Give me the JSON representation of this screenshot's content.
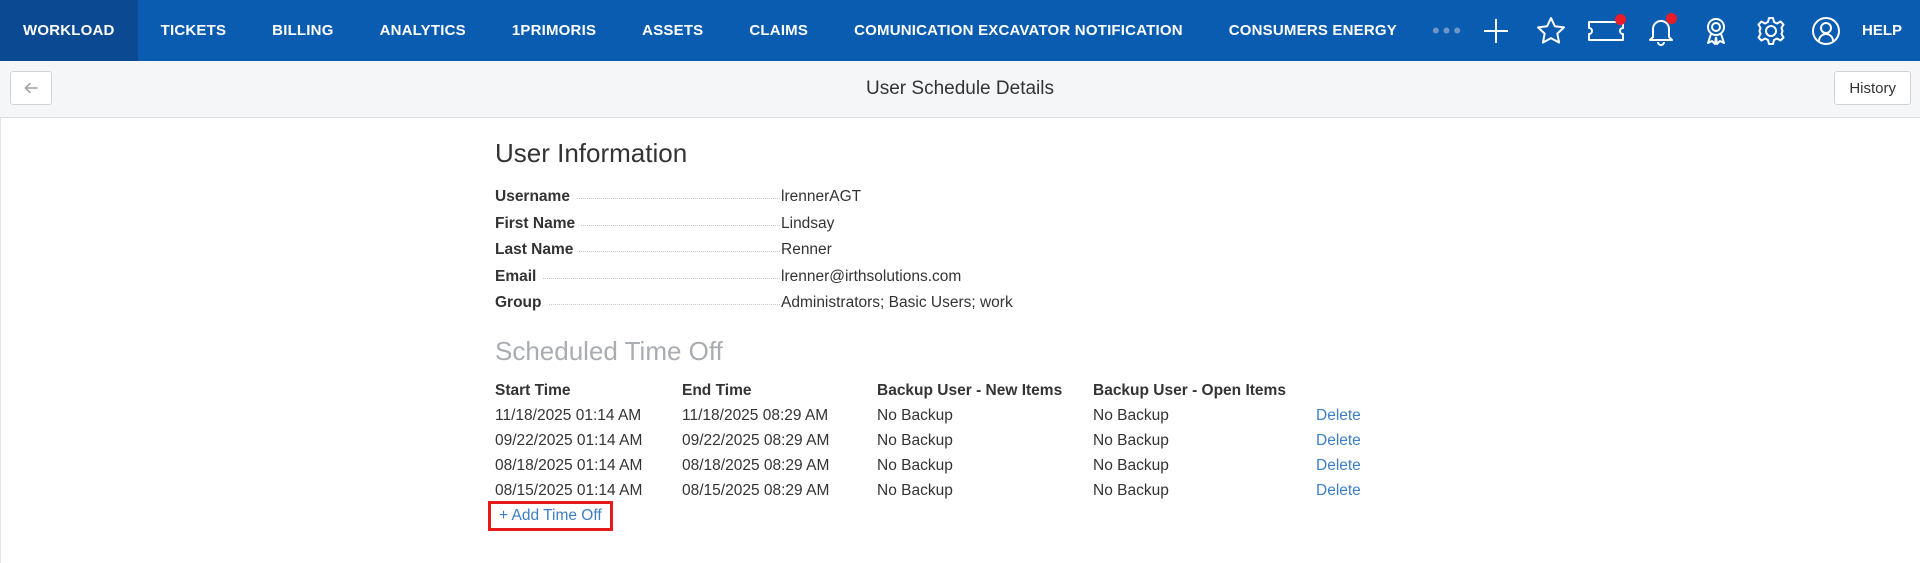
{
  "nav": {
    "items": [
      {
        "label": "WORKLOAD",
        "active": true
      },
      {
        "label": "TICKETS"
      },
      {
        "label": "BILLING"
      },
      {
        "label": "ANALYTICS"
      },
      {
        "label": "1PRIMORIS"
      },
      {
        "label": "ASSETS"
      },
      {
        "label": "CLAIMS"
      },
      {
        "label": "COMUNICATION EXCAVATOR NOTIFICATION"
      },
      {
        "label": "CONSUMERS ENERGY"
      }
    ],
    "more": "•••",
    "icons": [
      "plus-icon",
      "star-icon",
      "ticket-icon",
      "bell-icon",
      "award-icon",
      "gear-icon",
      "user-icon"
    ],
    "help": "HELP",
    "colors": {
      "bar": "#0a5cb0",
      "active": "#0b4a92",
      "notification_dot": "#ea1c2a"
    }
  },
  "header": {
    "title": "User Schedule Details",
    "history_label": "History"
  },
  "user_info": {
    "title": "User Information",
    "fields": [
      {
        "label": "Username",
        "value": "lrennerAGT"
      },
      {
        "label": "First Name",
        "value": "Lindsay"
      },
      {
        "label": "Last Name",
        "value": "Renner"
      },
      {
        "label": "Email",
        "value": "lrenner@irthsolutions.com"
      },
      {
        "label": "Group",
        "value": "Administrators; Basic Users; work"
      }
    ]
  },
  "schedule": {
    "title": "Scheduled Time Off",
    "columns": [
      "Start Time",
      "End Time",
      "Backup User - New Items",
      "Backup User - Open Items"
    ],
    "rows": [
      {
        "start": "11/18/2025 01:14 AM",
        "end": "11/18/2025 08:29 AM",
        "backup_new": "No Backup",
        "backup_open": "No Backup",
        "action": "Delete"
      },
      {
        "start": "09/22/2025 01:14 AM",
        "end": "09/22/2025 08:29 AM",
        "backup_new": "No Backup",
        "backup_open": "No Backup",
        "action": "Delete"
      },
      {
        "start": "08/18/2025 01:14 AM",
        "end": "08/18/2025 08:29 AM",
        "backup_new": "No Backup",
        "backup_open": "No Backup",
        "action": "Delete"
      },
      {
        "start": "08/15/2025 01:14 AM",
        "end": "08/15/2025 08:29 AM",
        "backup_new": "No Backup",
        "backup_open": "No Backup",
        "action": "Delete"
      }
    ],
    "add_label": "+ Add Time Off",
    "link_color": "#3d7fc4"
  }
}
